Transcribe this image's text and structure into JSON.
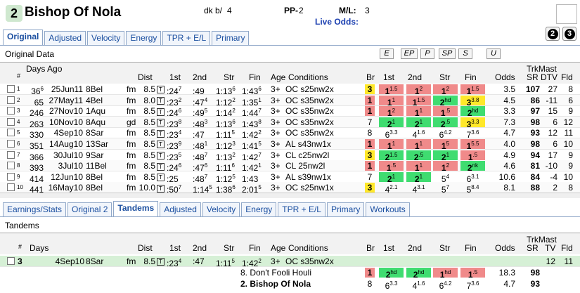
{
  "header": {
    "post": "2",
    "name": "Bishop Of Nola",
    "sex_label": "dk b/",
    "age": "4",
    "pp_label": "PP-",
    "pp_val": "2",
    "ml_label": "M/L:",
    "ml_val": "3",
    "live_odds": "Live Odds:"
  },
  "tabs_top": [
    "Original",
    "Adjusted",
    "Velocity",
    "Energy",
    "TPR + E/L",
    "Primary"
  ],
  "circles": [
    "2",
    "3"
  ],
  "section1": "Original Data",
  "filter_buttons": [
    "E",
    "EP",
    "P",
    "SP",
    "S",
    "U"
  ],
  "cols1": {
    "days_ago": "Days Ago",
    "hash": "#",
    "dist": "Dist",
    "first": "1st",
    "second": "2nd",
    "str": "Str",
    "fin": "Fin",
    "age": "Age",
    "cond": "Conditions",
    "br": "Br",
    "c1": "1st",
    "c2": "2nd",
    "cstr": "Str",
    "cfin": "Fin",
    "odds": "Odds",
    "trk": "TrkMast",
    "sr": "SR",
    "dtv": "DTV",
    "fld": "Fld",
    "tee": "T"
  },
  "rows": [
    {
      "n": "1",
      "days": "36",
      "ds": "6",
      "date": "25Jun11",
      "trk": "8Bel",
      "surf": "fm",
      "dist": "8.5",
      "f1": ":24",
      "s1": "7",
      "f2": ":49",
      "s2": "",
      "f3": "1:13",
      "s3": "6",
      "f4": "1:43",
      "s4": "6",
      "age": "3+",
      "cond": "OC s25nw2x",
      "br": "3",
      "brc": "yel",
      "p1": "1",
      "p1s": "1.5",
      "p1c": "red",
      "p2": "1",
      "p2s": "2",
      "p2c": "red",
      "p3": "1",
      "p3s": "2",
      "p3c": "red",
      "p4": "1",
      "p4s": "1.5",
      "p4c": "red",
      "odds": "3.5",
      "sr": "107",
      "dtv": "27",
      "fld": "8"
    },
    {
      "n": "2",
      "days": "65",
      "ds": "",
      "date": "27May11",
      "trk": "4Bel",
      "surf": "fm",
      "dist": "8.0",
      "f1": ":23",
      "s1": "2",
      "f2": ":47",
      "s2": "4",
      "f3": "1:12",
      "s3": "2",
      "f4": "1:35",
      "s4": "1",
      "age": "3+",
      "cond": "OC s35nw2x",
      "br": "1",
      "brc": "red",
      "p1": "1",
      "p1s": "1",
      "p1c": "red",
      "p2": "1",
      "p2s": "1.5",
      "p2c": "red",
      "p3": "2",
      "p3s": "hd",
      "p3c": "grn",
      "p4": "3",
      "p4s": "3.8",
      "p4c": "yel",
      "odds": "4.5",
      "sr": "86",
      "dtv": "-11",
      "fld": "6"
    },
    {
      "n": "3",
      "days": "246",
      "ds": "",
      "date": "27Nov10",
      "trk": "1Aqu",
      "surf": "fm",
      "dist": "8.5",
      "f1": ":24",
      "s1": "6",
      "f2": ":49",
      "s2": "5",
      "f3": "1:14",
      "s3": "2",
      "f4": "1:44",
      "s4": "7",
      "age": "3+",
      "cond": "OC s35nw2x",
      "br": "1",
      "brc": "red",
      "p1": "1",
      "p1s": "2",
      "p1c": "red",
      "p2": "1",
      "p2s": "1",
      "p2c": "red",
      "p3": "1",
      "p3s": ".5",
      "p3c": "red",
      "p4": "2",
      "p4s": "hd",
      "p4c": "grn",
      "odds": "3.3",
      "sr": "97",
      "dtv": "15",
      "fld": "9"
    },
    {
      "n": "4",
      "days": "263",
      "ds": "",
      "date": "10Nov10",
      "trk": "8Aqu",
      "surf": "gd",
      "dist": "8.5",
      "f1": ":23",
      "s1": "8",
      "f2": ":48",
      "s2": "3",
      "f3": "1:13",
      "s3": "6",
      "f4": "1:43",
      "s4": "8",
      "age": "3+",
      "cond": "OC s35nw2x",
      "br": "7",
      "brc": "",
      "p1": "2",
      "p1s": "1",
      "p1c": "grn",
      "p2": "2",
      "p2s": "1",
      "p2c": "grn",
      "p3": "2",
      "p3s": ".5",
      "p3c": "grn",
      "p4": "3",
      "p4s": "3.3",
      "p4c": "yel",
      "odds": "7.3",
      "sr": "98",
      "dtv": "6",
      "fld": "12"
    },
    {
      "n": "5",
      "days": "330",
      "ds": "",
      "date": "4Sep10",
      "trk": "8Sar",
      "surf": "fm",
      "dist": "8.5",
      "f1": ":23",
      "s1": "4",
      "f2": ":47",
      "s2": "",
      "f3": "1:11",
      "s3": "5",
      "f4": "1:42",
      "s4": "2",
      "age": "3+",
      "cond": "OC s35nw2x",
      "br": "8",
      "brc": "",
      "p1": "6",
      "p1s": "3.3",
      "p1c": "",
      "p2": "4",
      "p2s": "1.6",
      "p2c": "",
      "p3": "6",
      "p3s": "4.2",
      "p3c": "",
      "p4": "7",
      "p4s": "3.6",
      "p4c": "",
      "odds": "4.7",
      "sr": "93",
      "dtv": "12",
      "fld": "11"
    },
    {
      "n": "6",
      "days": "351",
      "ds": "",
      "date": "14Aug10",
      "trk": "13Sar",
      "surf": "fm",
      "dist": "8.5",
      "f1": ":23",
      "s1": "9",
      "f2": ":48",
      "s2": "1",
      "f3": "1:12",
      "s3": "3",
      "f4": "1:41",
      "s4": "5",
      "age": "3+",
      "cond": "AL s43nw1x",
      "br": "1",
      "brc": "red",
      "p1": "1",
      "p1s": "1",
      "p1c": "red",
      "p2": "1",
      "p2s": "1",
      "p2c": "red",
      "p3": "1",
      "p3s": "5",
      "p3c": "red",
      "p4": "1",
      "p4s": "5.5",
      "p4c": "red",
      "odds": "4.0",
      "sr": "98",
      "dtv": "6",
      "fld": "10"
    },
    {
      "n": "7",
      "days": "366",
      "ds": "",
      "date": "30Jul10",
      "trk": "9Sar",
      "surf": "fm",
      "dist": "8.5",
      "f1": ":23",
      "s1": "5",
      "f2": ":48",
      "s2": "7",
      "f3": "1:13",
      "s3": "2",
      "f4": "1:42",
      "s4": "7",
      "age": "3+",
      "cond": "CL c25nw2l",
      "br": "3",
      "brc": "yel",
      "p1": "2",
      "p1s": "1.5",
      "p1c": "grn",
      "p2": "2",
      "p2s": ".5",
      "p2c": "grn",
      "p3": "2",
      "p3s": "1",
      "p3c": "grn",
      "p4": "1",
      "p4s": ".5",
      "p4c": "red",
      "odds": "4.9",
      "sr": "94",
      "dtv": "17",
      "fld": "9"
    },
    {
      "n": "8",
      "days": "393",
      "ds": "",
      "date": "3Jul10",
      "trk": "11Bel",
      "surf": "fm",
      "dist": "8.5",
      "f1": ":24",
      "s1": "6",
      "f2": ":47",
      "s2": "6",
      "f3": "1:11",
      "s3": "6",
      "f4": "1:42",
      "s4": "1",
      "age": "3+",
      "cond": "CL 25nw2l",
      "br": "1",
      "brc": "red",
      "p1": "1",
      "p1s": ".5",
      "p1c": "red",
      "p2": "1",
      "p2s": "1",
      "p2c": "red",
      "p3": "1",
      "p3s": "2",
      "p3c": "red",
      "p4": "2",
      "p4s": "nk",
      "p4c": "grn",
      "odds": "4.6",
      "sr": "81",
      "dtv": "-10",
      "fld": "9"
    },
    {
      "n": "9",
      "days": "414",
      "ds": "",
      "date": "12Jun10",
      "trk": "8Bel",
      "surf": "fm",
      "dist": "8.5",
      "f1": ":25",
      "s1": "",
      "f2": ":48",
      "s2": "7",
      "f3": "1:12",
      "s3": "5",
      "f4": "1:43",
      "s4": "",
      "age": "3+",
      "cond": "AL s39nw1x",
      "br": "7",
      "brc": "",
      "p1": "2",
      "p1s": "1",
      "p1c": "grn",
      "p2": "2",
      "p2s": "1",
      "p2c": "grn",
      "p3": "5",
      "p3s": "4",
      "p3c": "",
      "p4": "6",
      "p4s": "3.1",
      "p4c": "",
      "odds": "10.6",
      "sr": "84",
      "dtv": "-4",
      "fld": "10"
    },
    {
      "n": "10",
      "days": "441",
      "ds": "",
      "date": "16May10",
      "trk": "8Bel",
      "surf": "fm",
      "dist": "10.0",
      "f1": ":50",
      "s1": "7",
      "f2": "1:14",
      "s2": "5",
      "f3": "1:38",
      "s3": "6",
      "f4": "2:01",
      "s4": "5",
      "age": "3+",
      "cond": "OC s25nw1x",
      "br": "3",
      "brc": "yel",
      "p1": "4",
      "p1s": "2.1",
      "p1c": "",
      "p2": "4",
      "p2s": "3.1",
      "p2c": "",
      "p3": "5",
      "p3s": "7",
      "p3c": "",
      "p4": "5",
      "p4s": "8.4",
      "p4c": "",
      "odds": "8.1",
      "sr": "88",
      "dtv": "2",
      "fld": "8"
    }
  ],
  "tabs_bottom": [
    "Earnings/Stats",
    "Original 2",
    "Tandems",
    "Adjusted",
    "Velocity",
    "Energy",
    "TPR + E/L",
    "Primary",
    "Workouts"
  ],
  "section2": "Tandems",
  "cols2": {
    "hash": "#",
    "days": "Days",
    "dist": "Dist",
    "first": "1st",
    "second": "2nd",
    "str": "Str",
    "fin": "Fin",
    "age": "Age",
    "cond": "Conditions",
    "br": "Br",
    "c1": "1st",
    "c2": "2nd",
    "cstr": "Str",
    "cfin": "Fin",
    "odds": "Odds",
    "trk": "TrkMast",
    "sr": "SR",
    "tv": "TV",
    "fld": "Fld"
  },
  "tandem": {
    "n": "3",
    "date": "4Sep10",
    "trk": "8Sar",
    "surf": "fm",
    "dist": "8.5",
    "f1": ":23",
    "s1": "4",
    "f2": ":47",
    "f3": "1:11",
    "s3": "5",
    "f4": "1:42",
    "s4": "2",
    "age": "3+",
    "cond": "OC s35nw2x",
    "tv": "12",
    "fld": "11"
  },
  "tandem_rows": [
    {
      "label": "8.  Don't Fooli Houli",
      "bold": false,
      "br": "1",
      "brc": "red",
      "p1": "2",
      "p1s": "hd",
      "p1c": "grn",
      "p2": "2",
      "p2s": "hd",
      "p2c": "grn",
      "p3": "1",
      "p3s": "hd",
      "p3c": "red",
      "p4": "1",
      "p4s": ".5",
      "p4c": "red",
      "odds": "18.3",
      "sr": "98"
    },
    {
      "label": "2.  Bishop Of Nola",
      "bold": true,
      "br": "8",
      "brc": "",
      "p1": "6",
      "p1s": "3.3",
      "p1c": "",
      "p2": "4",
      "p2s": "1.6",
      "p2c": "",
      "p3": "6",
      "p3s": "4.2",
      "p3c": "",
      "p4": "7",
      "p4s": "3.6",
      "p4c": "",
      "odds": "4.7",
      "sr": "93"
    }
  ]
}
